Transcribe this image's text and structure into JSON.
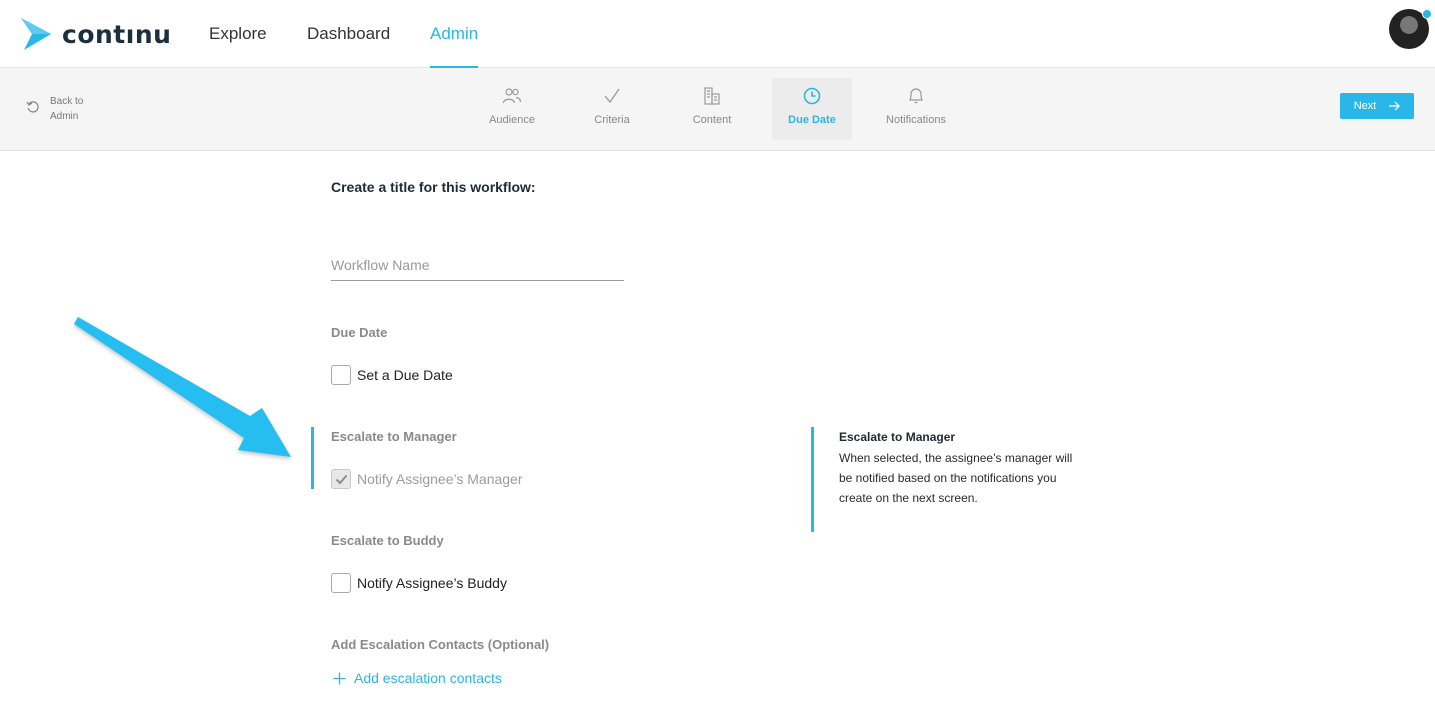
{
  "brand": {
    "name": "contınu",
    "accent": "#29b6e8"
  },
  "nav": {
    "items": [
      {
        "label": "Explore"
      },
      {
        "label": "Dashboard"
      },
      {
        "label": "Admin"
      }
    ],
    "active": "Admin"
  },
  "back": {
    "label": "Back to Admin"
  },
  "steps": [
    {
      "label": "Audience",
      "icon": "people-icon"
    },
    {
      "label": "Criteria",
      "icon": "check-icon"
    },
    {
      "label": "Content",
      "icon": "building-icon"
    },
    {
      "label": "Due Date",
      "icon": "clock-icon",
      "active": true
    },
    {
      "label": "Notifications",
      "icon": "bell-icon"
    }
  ],
  "next_button": {
    "label": "Next"
  },
  "form": {
    "title": "Create a title for this workflow:",
    "workflow_name": {
      "value": "",
      "placeholder": "Workflow Name"
    },
    "due_date": {
      "section": "Due Date",
      "checkbox_label": "Set a Due Date",
      "checked": false
    },
    "escalate_manager": {
      "section": "Escalate to Manager",
      "checkbox_label": "Notify Assignee’s Manager",
      "checked": true,
      "disabled": true
    },
    "escalate_buddy": {
      "section": "Escalate to Buddy",
      "checkbox_label": "Notify Assignee’s Buddy",
      "checked": false
    },
    "escalation_contacts": {
      "section": "Add Escalation Contacts (Optional)",
      "add_label": "Add escalation contacts"
    }
  },
  "info_panel": {
    "title": "Escalate to Manager",
    "text": "When selected, the assignee’s manager will be notified based on the notifications you create on the next screen."
  }
}
